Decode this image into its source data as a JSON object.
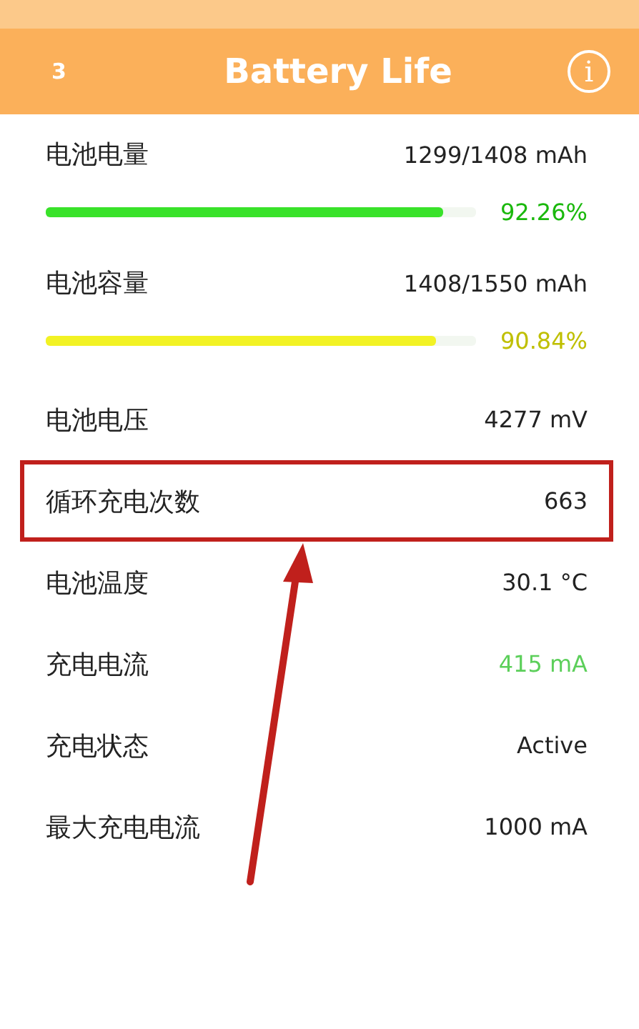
{
  "header": {
    "left_label": "3",
    "title": "Battery Life",
    "info_icon": "i"
  },
  "rows": [
    {
      "kind": "bar",
      "label": "电池电量",
      "value": "1299/1408 mAh",
      "level": 0.9226,
      "percent": "92.26%",
      "color": "#39e22a",
      "highlighted": false
    },
    {
      "kind": "bar",
      "label": "电池容量",
      "value": "1408/1550 mAh",
      "level": 0.9084,
      "percent": "90.84%",
      "color": "#f2f224",
      "highlighted": false
    },
    {
      "kind": "plain",
      "label": "电池电压",
      "value": "4277 mV",
      "highlighted": false
    },
    {
      "kind": "plain",
      "label": "循环充电次数",
      "value": "663",
      "highlighted": true
    },
    {
      "kind": "plain",
      "label": "电池温度",
      "value": "30.1 °C",
      "highlighted": false
    },
    {
      "kind": "plain",
      "label": "充电电流",
      "value": "415 mA",
      "color": "#5ccf5a",
      "highlighted": false
    },
    {
      "kind": "plain",
      "label": "充电状态",
      "value": "Active",
      "highlighted": false
    },
    {
      "kind": "plain",
      "label": "最大充电电流",
      "value": "1000 mA",
      "highlighted": false
    }
  ]
}
